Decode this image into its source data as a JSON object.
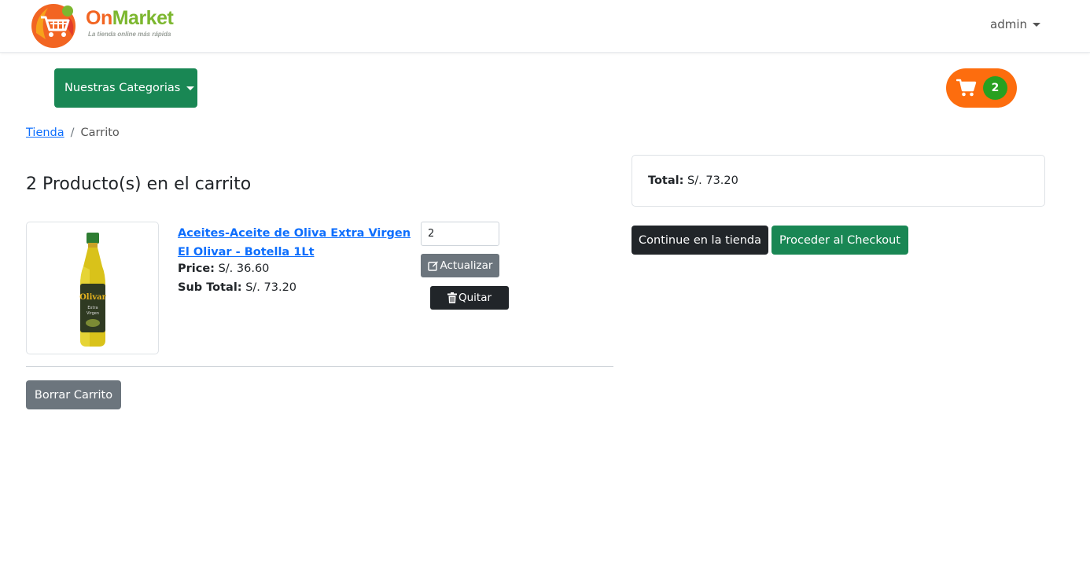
{
  "brand": {
    "name_part1": "On",
    "name_part2": "Market",
    "tagline": "La tienda online más rápida",
    "colors": {
      "orange": "#f26522",
      "green": "#7cb72f"
    }
  },
  "navbar": {
    "user_label": "admin"
  },
  "categories_button": {
    "label": "Nuestras Categorias"
  },
  "cart_pill": {
    "count": "2",
    "icon": "shopping-cart-icon",
    "bg_color": "#fd6d0e",
    "badge_color": "#28a020"
  },
  "breadcrumb": {
    "items": [
      {
        "label": "Tienda",
        "link": true
      },
      {
        "label": "Carrito",
        "link": false
      }
    ],
    "separator": "/"
  },
  "cart": {
    "heading": "2 Producto(s) en el carrito",
    "items": [
      {
        "title": "Aceites-Aceite de Oliva Extra Virgen El Olivar - Botella 1Lt",
        "price_label": "Price:",
        "price_value": "S/. 36.60",
        "subtotal_label": "Sub Total:",
        "subtotal_value": "S/. 73.20",
        "quantity": "2",
        "update_label": "Actualizar",
        "remove_label": "Quitar",
        "image": "olive-oil-bottle"
      }
    ],
    "clear_label": "Borrar Carrito"
  },
  "summary": {
    "total_label": "Total:",
    "total_value": "S/. 73.20",
    "continue_label": "Continue en la tienda",
    "checkout_label": "Proceder al Checkout"
  }
}
